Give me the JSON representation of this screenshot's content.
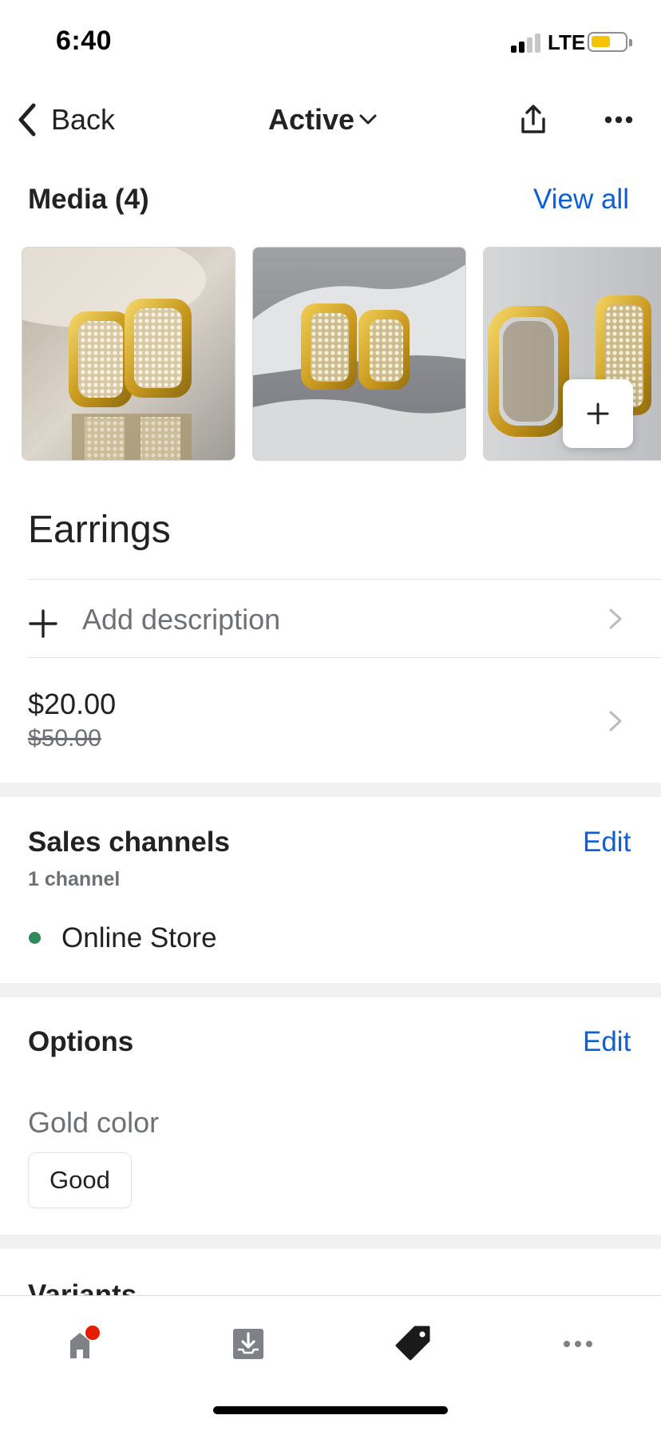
{
  "status_bar": {
    "time": "6:40",
    "network": "LTE"
  },
  "nav": {
    "back_label": "Back",
    "status_label": "Active"
  },
  "media": {
    "heading": "Media (4)",
    "view_all_label": "View all",
    "count": 4
  },
  "product": {
    "title": "Earrings",
    "add_description_label": "Add description",
    "price": "$20.00",
    "compare_at_price": "$50.00"
  },
  "sales_channels": {
    "heading": "Sales channels",
    "edit_label": "Edit",
    "count_text": "1 channel",
    "channels": [
      {
        "name": "Online Store",
        "status_color": "#2e8a5a"
      }
    ]
  },
  "options": {
    "heading": "Options",
    "edit_label": "Edit",
    "items": [
      {
        "name": "Gold color",
        "values": [
          "Good"
        ]
      }
    ]
  },
  "variants": {
    "heading": "Variants"
  },
  "tab_bar": {
    "tabs": [
      {
        "icon": "home-icon",
        "badge": true,
        "active": false
      },
      {
        "icon": "orders-inbox-icon",
        "active": false
      },
      {
        "icon": "product-tag-icon",
        "active": true
      },
      {
        "icon": "more-icon",
        "active": false
      }
    ]
  },
  "colors": {
    "link": "#0b5fd8",
    "badge": "#e51c00",
    "text": "#202223",
    "muted": "#6d7175",
    "battery": "#f5c400"
  }
}
